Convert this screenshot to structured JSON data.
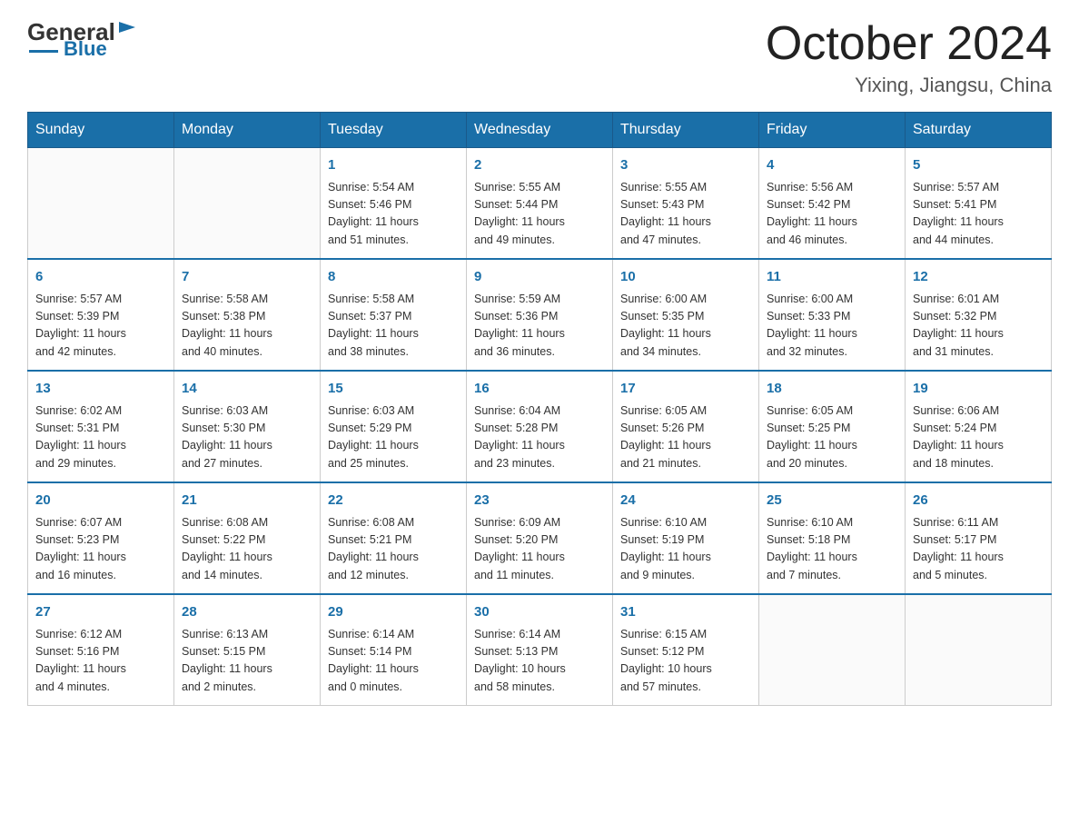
{
  "header": {
    "logo_general": "General",
    "logo_blue": "Blue",
    "month_title": "October 2024",
    "location": "Yixing, Jiangsu, China"
  },
  "days_of_week": [
    "Sunday",
    "Monday",
    "Tuesday",
    "Wednesday",
    "Thursday",
    "Friday",
    "Saturday"
  ],
  "weeks": [
    [
      {
        "day": "",
        "info": ""
      },
      {
        "day": "",
        "info": ""
      },
      {
        "day": "1",
        "info": "Sunrise: 5:54 AM\nSunset: 5:46 PM\nDaylight: 11 hours\nand 51 minutes."
      },
      {
        "day": "2",
        "info": "Sunrise: 5:55 AM\nSunset: 5:44 PM\nDaylight: 11 hours\nand 49 minutes."
      },
      {
        "day": "3",
        "info": "Sunrise: 5:55 AM\nSunset: 5:43 PM\nDaylight: 11 hours\nand 47 minutes."
      },
      {
        "day": "4",
        "info": "Sunrise: 5:56 AM\nSunset: 5:42 PM\nDaylight: 11 hours\nand 46 minutes."
      },
      {
        "day": "5",
        "info": "Sunrise: 5:57 AM\nSunset: 5:41 PM\nDaylight: 11 hours\nand 44 minutes."
      }
    ],
    [
      {
        "day": "6",
        "info": "Sunrise: 5:57 AM\nSunset: 5:39 PM\nDaylight: 11 hours\nand 42 minutes."
      },
      {
        "day": "7",
        "info": "Sunrise: 5:58 AM\nSunset: 5:38 PM\nDaylight: 11 hours\nand 40 minutes."
      },
      {
        "day": "8",
        "info": "Sunrise: 5:58 AM\nSunset: 5:37 PM\nDaylight: 11 hours\nand 38 minutes."
      },
      {
        "day": "9",
        "info": "Sunrise: 5:59 AM\nSunset: 5:36 PM\nDaylight: 11 hours\nand 36 minutes."
      },
      {
        "day": "10",
        "info": "Sunrise: 6:00 AM\nSunset: 5:35 PM\nDaylight: 11 hours\nand 34 minutes."
      },
      {
        "day": "11",
        "info": "Sunrise: 6:00 AM\nSunset: 5:33 PM\nDaylight: 11 hours\nand 32 minutes."
      },
      {
        "day": "12",
        "info": "Sunrise: 6:01 AM\nSunset: 5:32 PM\nDaylight: 11 hours\nand 31 minutes."
      }
    ],
    [
      {
        "day": "13",
        "info": "Sunrise: 6:02 AM\nSunset: 5:31 PM\nDaylight: 11 hours\nand 29 minutes."
      },
      {
        "day": "14",
        "info": "Sunrise: 6:03 AM\nSunset: 5:30 PM\nDaylight: 11 hours\nand 27 minutes."
      },
      {
        "day": "15",
        "info": "Sunrise: 6:03 AM\nSunset: 5:29 PM\nDaylight: 11 hours\nand 25 minutes."
      },
      {
        "day": "16",
        "info": "Sunrise: 6:04 AM\nSunset: 5:28 PM\nDaylight: 11 hours\nand 23 minutes."
      },
      {
        "day": "17",
        "info": "Sunrise: 6:05 AM\nSunset: 5:26 PM\nDaylight: 11 hours\nand 21 minutes."
      },
      {
        "day": "18",
        "info": "Sunrise: 6:05 AM\nSunset: 5:25 PM\nDaylight: 11 hours\nand 20 minutes."
      },
      {
        "day": "19",
        "info": "Sunrise: 6:06 AM\nSunset: 5:24 PM\nDaylight: 11 hours\nand 18 minutes."
      }
    ],
    [
      {
        "day": "20",
        "info": "Sunrise: 6:07 AM\nSunset: 5:23 PM\nDaylight: 11 hours\nand 16 minutes."
      },
      {
        "day": "21",
        "info": "Sunrise: 6:08 AM\nSunset: 5:22 PM\nDaylight: 11 hours\nand 14 minutes."
      },
      {
        "day": "22",
        "info": "Sunrise: 6:08 AM\nSunset: 5:21 PM\nDaylight: 11 hours\nand 12 minutes."
      },
      {
        "day": "23",
        "info": "Sunrise: 6:09 AM\nSunset: 5:20 PM\nDaylight: 11 hours\nand 11 minutes."
      },
      {
        "day": "24",
        "info": "Sunrise: 6:10 AM\nSunset: 5:19 PM\nDaylight: 11 hours\nand 9 minutes."
      },
      {
        "day": "25",
        "info": "Sunrise: 6:10 AM\nSunset: 5:18 PM\nDaylight: 11 hours\nand 7 minutes."
      },
      {
        "day": "26",
        "info": "Sunrise: 6:11 AM\nSunset: 5:17 PM\nDaylight: 11 hours\nand 5 minutes."
      }
    ],
    [
      {
        "day": "27",
        "info": "Sunrise: 6:12 AM\nSunset: 5:16 PM\nDaylight: 11 hours\nand 4 minutes."
      },
      {
        "day": "28",
        "info": "Sunrise: 6:13 AM\nSunset: 5:15 PM\nDaylight: 11 hours\nand 2 minutes."
      },
      {
        "day": "29",
        "info": "Sunrise: 6:14 AM\nSunset: 5:14 PM\nDaylight: 11 hours\nand 0 minutes."
      },
      {
        "day": "30",
        "info": "Sunrise: 6:14 AM\nSunset: 5:13 PM\nDaylight: 10 hours\nand 58 minutes."
      },
      {
        "day": "31",
        "info": "Sunrise: 6:15 AM\nSunset: 5:12 PM\nDaylight: 10 hours\nand 57 minutes."
      },
      {
        "day": "",
        "info": ""
      },
      {
        "day": "",
        "info": ""
      }
    ]
  ]
}
